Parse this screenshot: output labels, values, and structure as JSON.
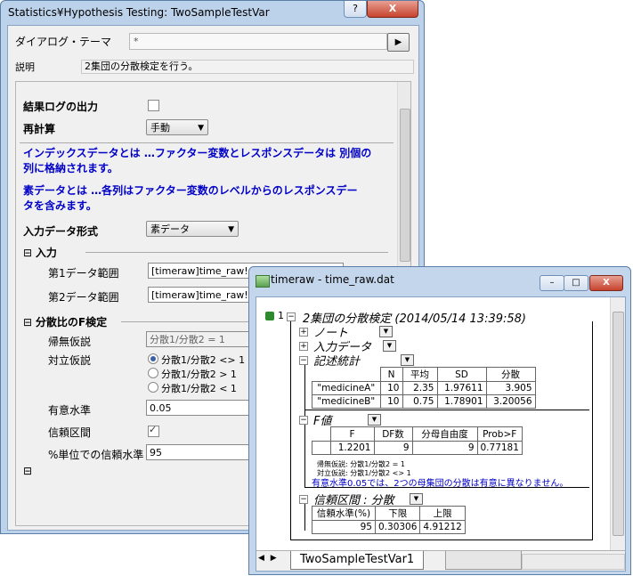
{
  "dialog": {
    "title": "Statistics¥Hypothesis Testing: TwoSampleTestVar",
    "help_label": "?",
    "close_label": "X",
    "theme_label": "ダイアログ・テーマ",
    "theme_value": "*",
    "theme_button": "▶",
    "desc_label": "説明",
    "desc_value": "2集団の分散検定を行う。",
    "log_label": "結果ログの出力",
    "recalc_label": "再計算",
    "recalc_value": "手動",
    "info1_line1": "インデックスデータとは …ファクター変数とレスポンスデータは 別個の",
    "info1_line2": "列に格納されます。",
    "info2_line1": "素データとは …各列はファクター変数のレベルからのレスポンスデー",
    "info2_line2": "タを含みます。",
    "input_format_label": "入力データ形式",
    "input_format_value": "素データ",
    "input_section": "入力",
    "data1_label": "第1データ範囲",
    "data1_value": "[timeraw]time_raw!A",
    "data2_label": "第2データ範囲",
    "data2_value": "[timeraw]time_raw!B",
    "ftest_section": "分散比のF検定",
    "null_label": "帰無仮説",
    "null_value": "分散1/分散2 = 1",
    "alt_label": "対立仮説",
    "alt_options": [
      "分散1/分散2 <> 1",
      "分散1/分散2 > 1",
      "分散1/分散2 < 1"
    ],
    "alt_selected": 0,
    "sig_label": "有意水準",
    "sig_value": "0.05",
    "ci_label": "信頼区間",
    "ci_checked": true,
    "ci_level_label": "%単位での信頼水準",
    "ci_level_value": "95",
    "collapse_glyph": "⊟"
  },
  "workbook": {
    "title": "timeraw - time_raw.dat",
    "min_label": "–",
    "max_label": "□",
    "close_label": "X",
    "row_number": "1",
    "report_title": "2集団の分散検定 (2014/05/14 13:39:58)",
    "nodes": {
      "note": "ノート",
      "input": "入力データ",
      "desc": "記述統計",
      "f": "F値",
      "ci": "信頼区間 : 分散"
    },
    "desc_table": {
      "headers": [
        "",
        "N",
        "平均",
        "SD",
        "分散"
      ],
      "rows": [
        [
          "\"medicineA\"",
          "10",
          "2.35",
          "1.97611",
          "3.905"
        ],
        [
          "\"medicineB\"",
          "10",
          "0.75",
          "1.78901",
          "3.20056"
        ]
      ]
    },
    "f_table": {
      "headers": [
        "F",
        "DF数",
        "分母自由度",
        "Prob>F"
      ],
      "row": [
        "1.2201",
        "9",
        "9",
        "0.77181"
      ]
    },
    "f_notes": {
      "null": "帰無仮説: 分散1/分散2 = 1",
      "alt": "対立仮説: 分散1/分散2 <> 1",
      "conclusion": "有意水準0.05では、2つの母集団の分散は有意に異なりません。"
    },
    "ci_table": {
      "headers": [
        "信頼水準(%)",
        "下限",
        "上限"
      ],
      "row": [
        "95",
        "0.30306",
        "4.91212"
      ]
    },
    "sheet_tab": "TwoSampleTestVar1",
    "tab_arrows": "◀ ▶"
  },
  "colors": {
    "blue_text": "#0000c8",
    "frame": "#bcd1ea",
    "close_red": "#c7432e"
  }
}
